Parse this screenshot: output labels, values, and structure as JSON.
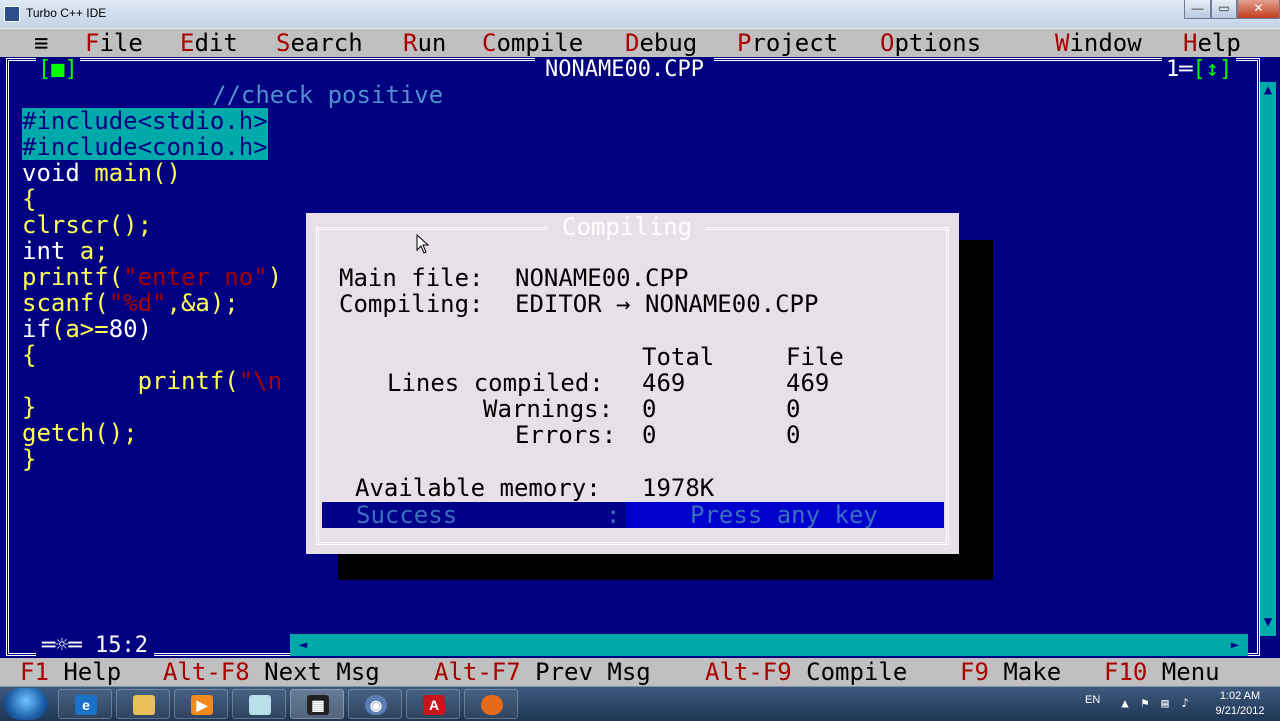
{
  "window": {
    "title": "Turbo C++ IDE",
    "min": "—",
    "max": "▭",
    "close": "✕"
  },
  "menu": {
    "system": "≡",
    "items": [
      {
        "key": "F",
        "rest": "ile"
      },
      {
        "key": "E",
        "rest": "dit"
      },
      {
        "key": "S",
        "rest": "earch"
      },
      {
        "key": "R",
        "rest": "un"
      },
      {
        "key": "C",
        "rest": "ompile"
      },
      {
        "key": "D",
        "rest": "ebug"
      },
      {
        "key": "P",
        "rest": "roject"
      },
      {
        "key": "O",
        "rest": "ptions"
      },
      {
        "key": "W",
        "rest": "indow"
      },
      {
        "key": "H",
        "rest": "elp"
      }
    ]
  },
  "editor": {
    "close_box": "[■]",
    "filename": "NONAME00.CPP",
    "window_number": "1",
    "zoom_box": "[↕]",
    "position": "15:2",
    "position_prefix": "═☼═",
    "code": {
      "l1": "//check positive",
      "l2": "#include<stdio.h>",
      "l3": "#include<conio.h>",
      "l4a": "void",
      "l4b": " main()",
      "l5": "{",
      "l6": "clrscr();",
      "l7a": "int",
      "l7b": " a;",
      "l8a": "printf(",
      "l8b": "\"enter no\"",
      "l8c": ")",
      "l9a": "scanf(",
      "l9b": "\"%d\"",
      "l9c": ",&a);",
      "l10a": "if",
      "l10b": "(a>=",
      "l10c": "80",
      "l10d": ")",
      "l11": "{",
      "l12a": "        printf(",
      "l12b": "\"\\n",
      "l13": "}",
      "l14": "getch();",
      "l15": "}"
    }
  },
  "dialog": {
    "title": "Compiling",
    "main_file_label": "Main file:",
    "main_file": "NONAME00.CPP",
    "compiling_label": "Compiling:",
    "compiling_value": "EDITOR → NONAME00.CPP",
    "col_total": "Total",
    "col_file": "File",
    "rows": [
      {
        "label": "Lines compiled:",
        "total": "469",
        "file": "469"
      },
      {
        "label": "Warnings:",
        "total": "0",
        "file": "0"
      },
      {
        "label": "Errors:",
        "total": "0",
        "file": "0"
      }
    ],
    "memory_label": "Available memory:",
    "memory_value": "1978K",
    "status": "Success",
    "status_sep": ":",
    "prompt": "Press any key"
  },
  "statusline": [
    {
      "key": "F1",
      "label": " Help"
    },
    {
      "key": "Alt-F8",
      "label": " Next Msg"
    },
    {
      "key": "Alt-F7",
      "label": " Prev Msg"
    },
    {
      "key": "Alt-F9",
      "label": " Compile"
    },
    {
      "key": "F9",
      "label": " Make"
    },
    {
      "key": "F10",
      "label": " Menu"
    }
  ],
  "taskbar": {
    "language": "EN",
    "time": "1:02 AM",
    "date": "9/21/2012"
  },
  "colors": {
    "editor_bg": "#000080",
    "menu_bg": "#c0c0c0",
    "hotkey": "#aa0000",
    "code_text": "#ffff55",
    "selection": "#00aaaa",
    "dialog_bg": "#e8e0e8"
  }
}
